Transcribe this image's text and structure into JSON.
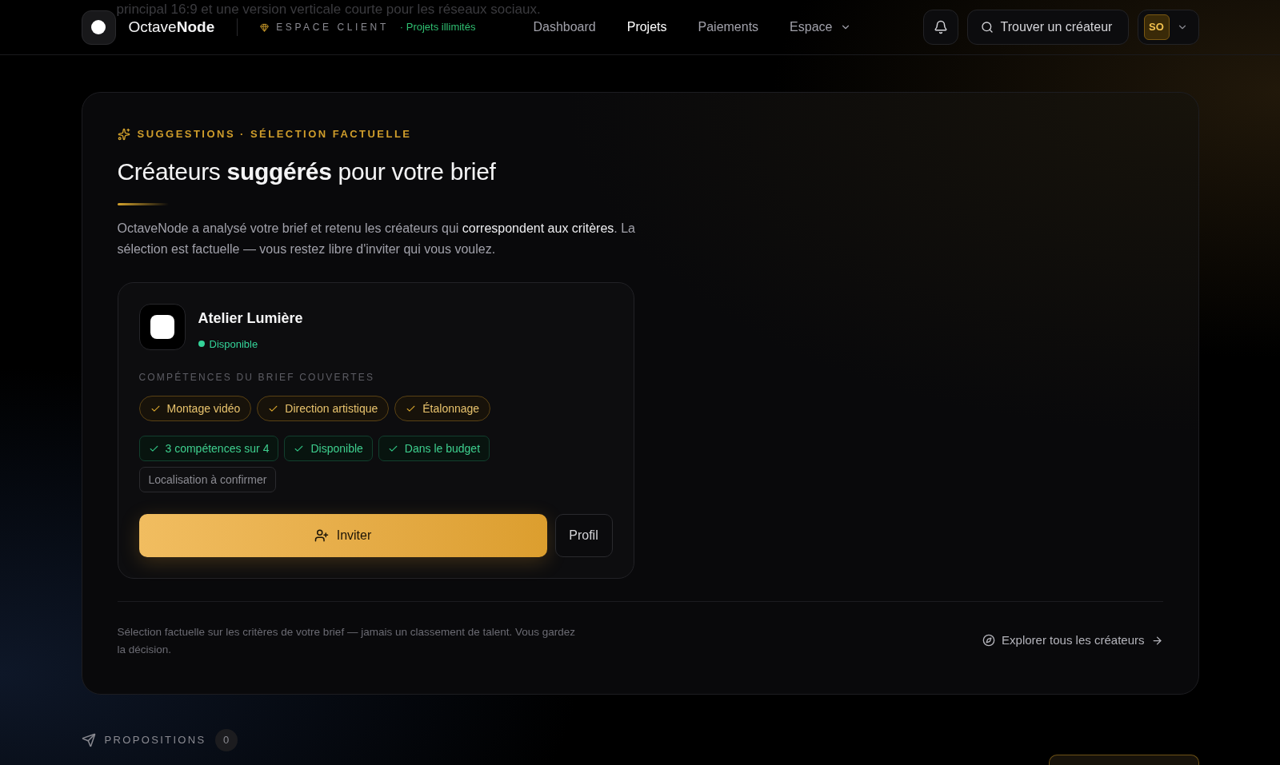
{
  "background_text": "principal 16:9 et une version verticale courte pour les réseaux sociaux.",
  "header": {
    "brand": "Octave**Node**",
    "workspace_label": "ESPACE CLIENT",
    "plan": "· Projets illimités",
    "nav": [
      {
        "label": "Dashboard",
        "selected": false,
        "kind": "link"
      },
      {
        "label": "Projets",
        "selected": true,
        "kind": "link"
      },
      {
        "label": "Paiements",
        "selected": false,
        "kind": "link"
      },
      {
        "label": "Espace",
        "selected": false,
        "kind": "menu"
      }
    ],
    "search_label": "Trouver un créateur",
    "user_initials": "SO"
  },
  "suggestions": {
    "eyebrow": "SUGGESTIONS · SÉLECTION FACTUELLE",
    "title": "Créateurs **suggérés** pour votre brief",
    "intro": "OctaveNode a analysé votre brief et retenu les créateurs qui **correspondent aux critères**. La sélection est factuelle — vous restez libre d'inviter qui vous voulez.",
    "creators": [
      {
        "name": "Atelier Lumière",
        "status": "Disponible",
        "available": true,
        "skills_label": "COMPÉTENCES DU BRIEF COUVERTES",
        "skills": [
          {
            "label": "Montage vidéo",
            "covered": true
          },
          {
            "label": "Direction artistique",
            "covered": true
          },
          {
            "label": "Étalonnage",
            "covered": true
          }
        ],
        "criteria": [
          {
            "label": "3 compétences sur 4",
            "met": true
          },
          {
            "label": "Disponible",
            "met": true
          },
          {
            "label": "Dans le budget",
            "met": true
          },
          {
            "label": "Localisation à confirmer",
            "met": false
          }
        ],
        "invite_label": "Inviter",
        "profile_label": "Profil"
      }
    ],
    "footer_note": "Sélection factuelle sur les critères de votre brief — jamais un classement de talent. Vous gardez la décision.",
    "explore_link": "Explorer tous les créateurs"
  },
  "proposals": {
    "title": "PROPOSITIONS",
    "count": "0"
  }
}
